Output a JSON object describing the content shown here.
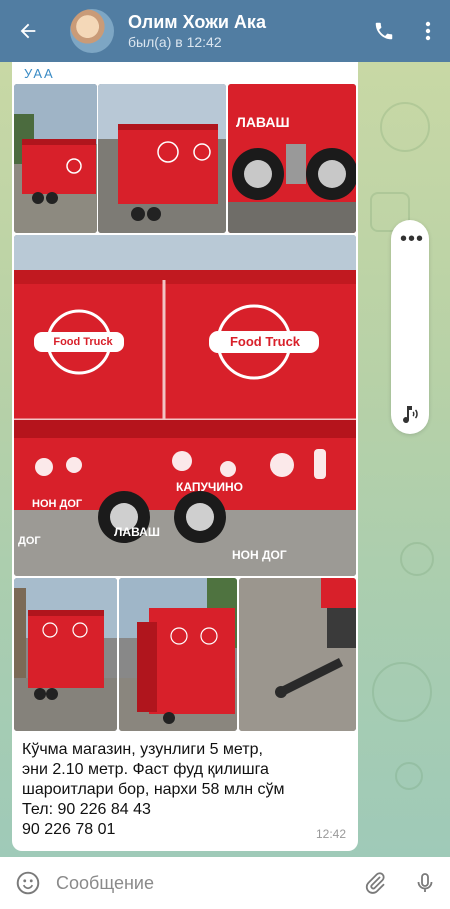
{
  "header": {
    "title": "Олим Хожи Ака",
    "status": "был(а) в 12:42"
  },
  "message": {
    "sender": "УАА",
    "caption_lines": [
      "Кўчма магазин, узунлиги 5 метр,",
      "эни 2.10 метр. Фаст фуд қилишга",
      "шароитлари бор, нархи 58 млн сўм",
      "Тел: 90 226 84 43",
      "90 226 78 01"
    ],
    "time": "12:42",
    "truck_texts": {
      "brand": "Food Truck",
      "lavash": "ЛАВАШ",
      "kapuchino": "КАПУЧИНО",
      "hotdog": "НОН ДОГ",
      "hotdog2": "НОН ДОГ",
      "dog": "ДОГ",
      "lavash2": "ЛАВАШ"
    }
  },
  "input": {
    "placeholder": "Сообщение"
  },
  "colors": {
    "header": "#517da2",
    "truck_red": "#d8202a",
    "accent": "#3a8bc5"
  }
}
